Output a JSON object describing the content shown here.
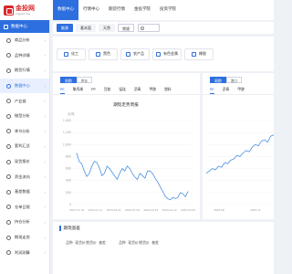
{
  "logo": {
    "title": "金投网",
    "subtitle": "cngold.org"
  },
  "nav": [
    "数据中心",
    "行情中心",
    "期货行情",
    "金投学院",
    "投资学院"
  ],
  "sidebar": {
    "header": "数据中心",
    "items": [
      {
        "label": "商品分析",
        "active": false
      },
      {
        "label": "品种详情",
        "active": false
      },
      {
        "label": "期货行情",
        "active": false
      },
      {
        "label": "数据中心",
        "active": true
      },
      {
        "label": "产业链",
        "active": false
      },
      {
        "label": "微型分析",
        "active": false
      },
      {
        "label": "季节分析",
        "active": false
      },
      {
        "label": "套利汇总",
        "active": false
      },
      {
        "label": "现货报价",
        "active": false
      },
      {
        "label": "资金流向",
        "active": false
      },
      {
        "label": "基差数据",
        "active": false
      },
      {
        "label": "仓单日报",
        "active": false
      },
      {
        "label": "持仓分析",
        "active": false
      },
      {
        "label": "期现走势",
        "active": false
      },
      {
        "label": "利润测算",
        "active": false
      }
    ]
  },
  "filters": {
    "chips": [
      {
        "label": "能源",
        "active": true
      },
      {
        "label": "基本面",
        "active": false
      },
      {
        "label": "天然",
        "active": false
      }
    ],
    "select": "常规"
  },
  "categories": [
    "化工",
    "黑色",
    "农产品",
    "有色金属",
    "橡胶"
  ],
  "panel1": {
    "tabs": [
      {
        "label": "周期",
        "active": true
      },
      {
        "label": "库存",
        "active": false
      }
    ],
    "subtabs": [
      {
        "label": "PE",
        "active": true
      },
      {
        "label": "聚丙烯",
        "active": false
      },
      {
        "label": "PP",
        "active": false
      },
      {
        "label": "豆粕",
        "active": false
      },
      {
        "label": "锰硅",
        "active": false
      },
      {
        "label": "沥青",
        "active": false
      },
      {
        "label": "甲醇",
        "active": false
      },
      {
        "label": "塑料",
        "active": false
      }
    ]
  },
  "panel2": {
    "tabs": [
      {
        "label": "周期",
        "active": true
      },
      {
        "label": "港口",
        "active": false
      }
    ],
    "subtabs": [
      {
        "label": "PE",
        "active": true
      },
      {
        "label": "沥青",
        "active": false
      },
      {
        "label": "甲醇",
        "active": false
      }
    ]
  },
  "chart_data": [
    {
      "type": "line",
      "title": "期现走势周报",
      "ylabel": "元/吨",
      "yticks": [
        "1,400",
        "1,200",
        "1,000",
        "800",
        "600",
        "400",
        "200",
        "0"
      ],
      "ylim": [
        0,
        1400
      ],
      "xticks": [
        "2023.11.18",
        "2024.01.11",
        "2024.04.01",
        "2024.07.04",
        "2024.09.23",
        "2024.12.12",
        "2025.03.09"
      ],
      "series": [
        {
          "color": "#4a90e2",
          "values": [
            860,
            720,
            680,
            560,
            470,
            520,
            640,
            720,
            700,
            610,
            480,
            520,
            640,
            600,
            540,
            480,
            420,
            520,
            600,
            560,
            640,
            600,
            520,
            460,
            420,
            520,
            480,
            440,
            560,
            560,
            520,
            440,
            380,
            300,
            220,
            140,
            100,
            80,
            120,
            100,
            120,
            200,
            180,
            130,
            220
          ]
        }
      ]
    },
    {
      "type": "line",
      "xticks": [
        "2024.08",
        "2024.11"
      ],
      "series": [
        {
          "color": "#4a90e2",
          "values": [
            520,
            560,
            600,
            580,
            640,
            620,
            700,
            680,
            740,
            760,
            820,
            800,
            860,
            900,
            880,
            960,
            1000,
            980,
            1060,
            1080,
            1040,
            1140,
            1160
          ]
        }
      ]
    }
  ],
  "bottom": {
    "title": "期现基差",
    "columns": [
      "品种",
      "现货价",
      "期货价",
      "基差",
      "品种",
      "现货价",
      "期货价",
      "基差"
    ]
  }
}
